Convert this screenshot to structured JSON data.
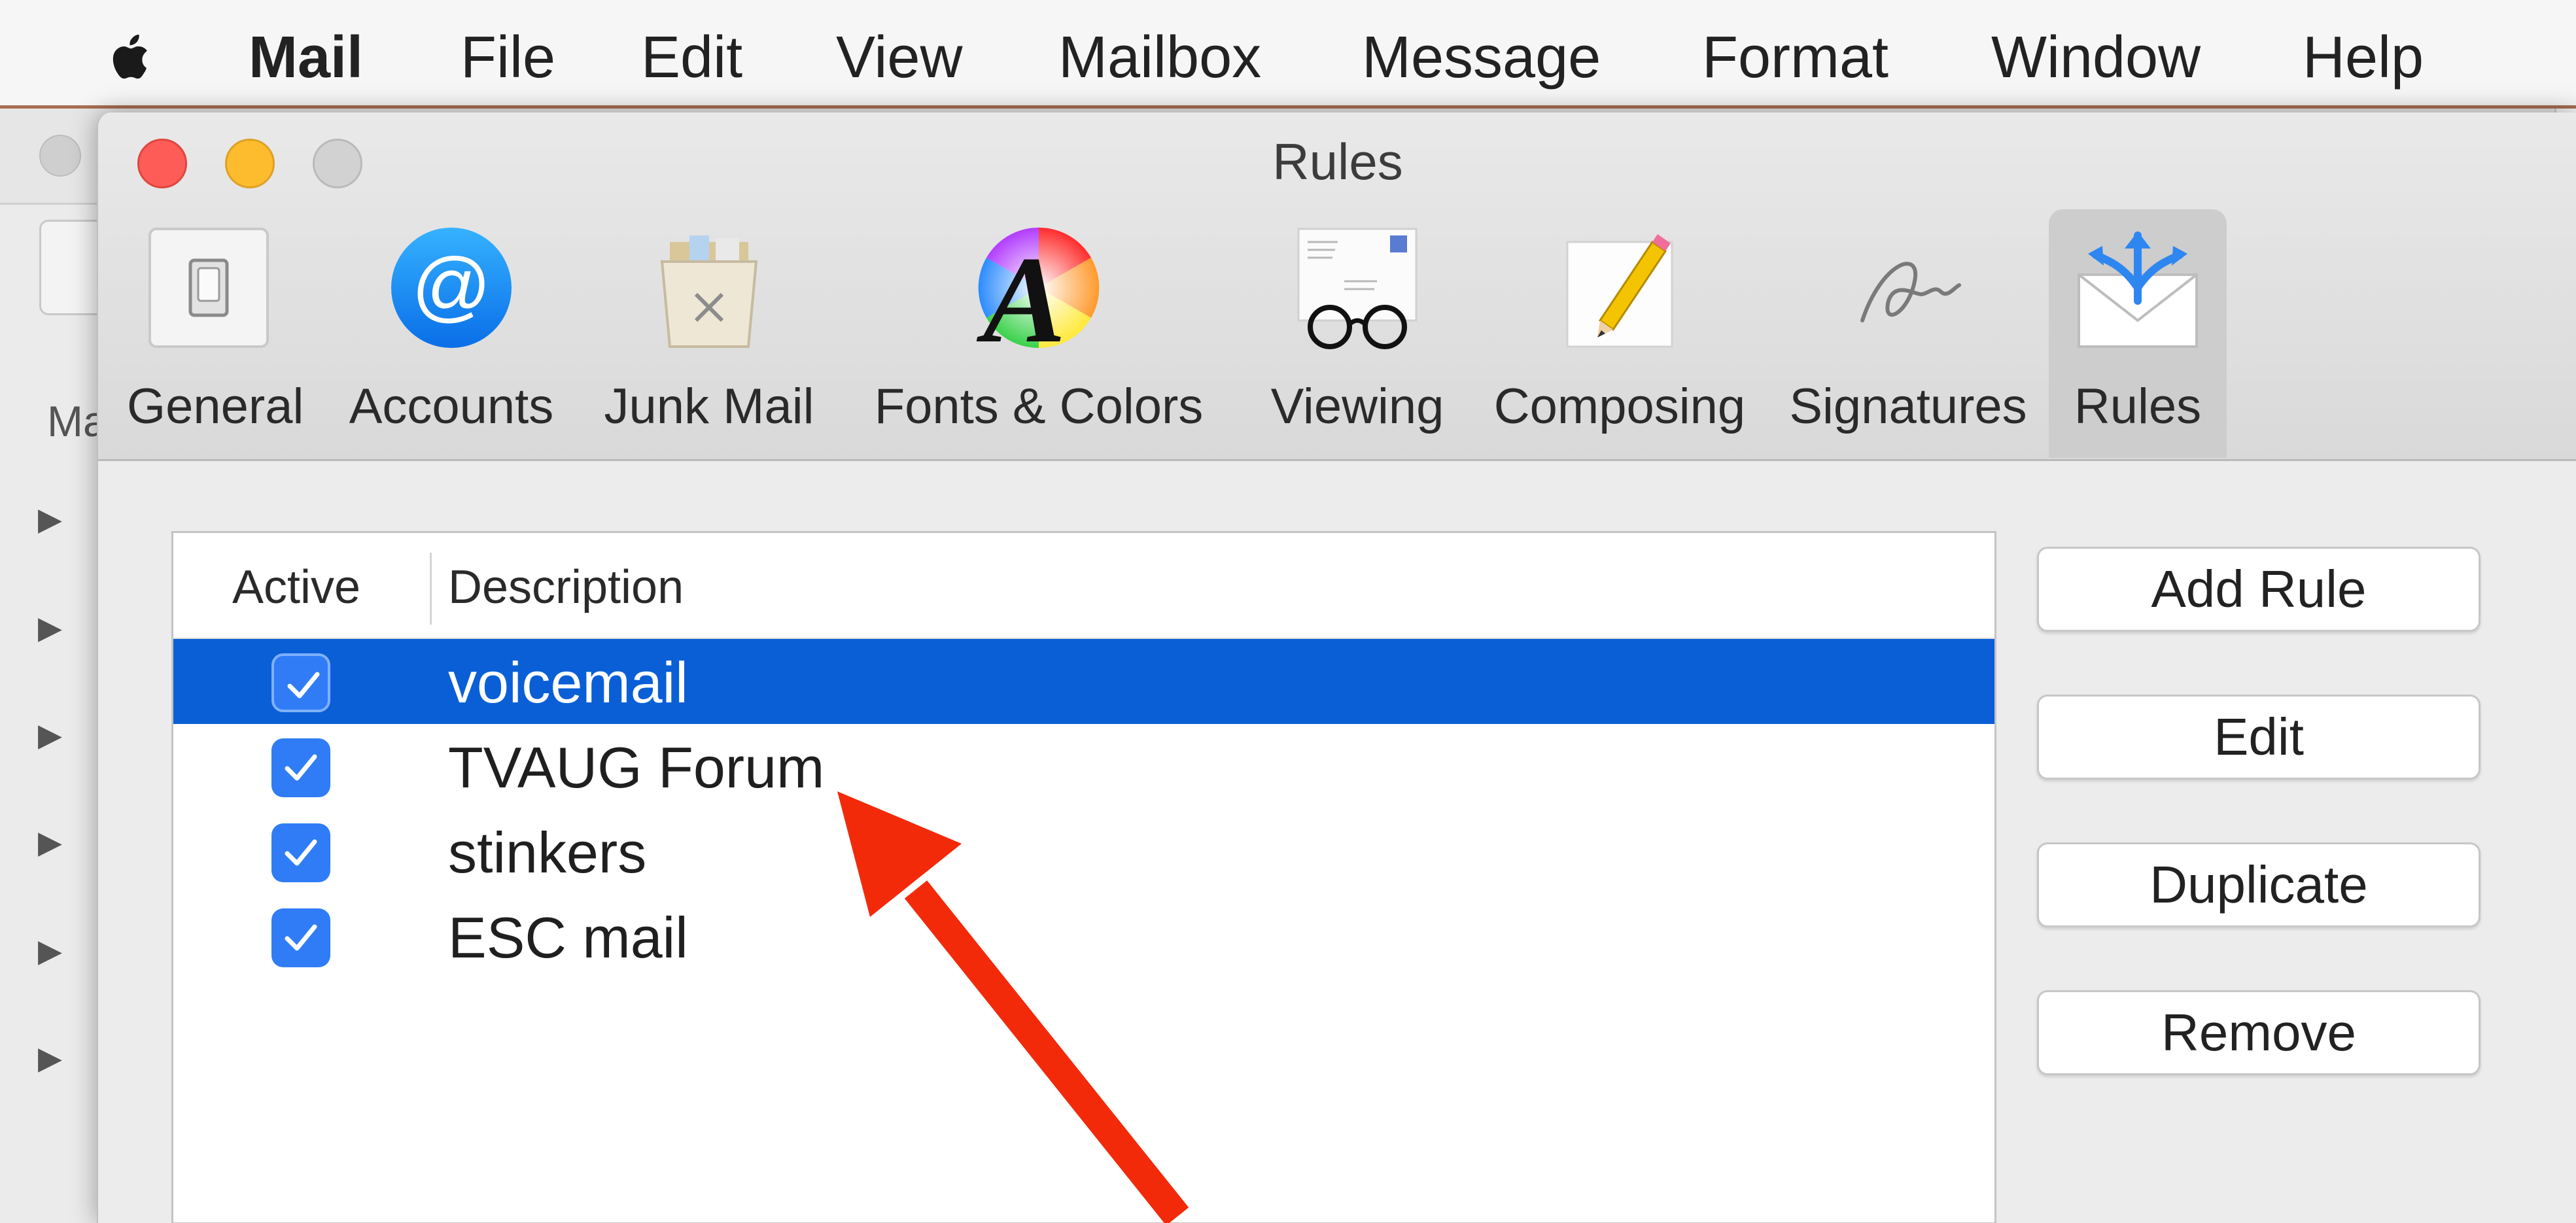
{
  "menubar": {
    "items": [
      "Mail",
      "File",
      "Edit",
      "View",
      "Mailbox",
      "Message",
      "Format",
      "Window",
      "Help"
    ]
  },
  "background_window": {
    "sidebar_header": "Ma"
  },
  "prefs_window": {
    "title": "Rules",
    "tabs": [
      {
        "label": "General",
        "icon": "light-switch-icon"
      },
      {
        "label": "Accounts",
        "icon": "at-sign-icon"
      },
      {
        "label": "Junk Mail",
        "icon": "trash-bin-icon"
      },
      {
        "label": "Fonts & Colors",
        "icon": "font-color-wheel-icon"
      },
      {
        "label": "Viewing",
        "icon": "glasses-letter-icon"
      },
      {
        "label": "Composing",
        "icon": "pencil-paper-icon"
      },
      {
        "label": "Signatures",
        "icon": "signature-icon"
      },
      {
        "label": "Rules",
        "icon": "envelope-arrows-icon",
        "selected": true
      }
    ]
  },
  "rules_table": {
    "headers": {
      "active": "Active",
      "description": "Description"
    },
    "rows": [
      {
        "name": "voicemail",
        "active": true,
        "selected": true
      },
      {
        "name": "TVAUG Forum",
        "active": true,
        "selected": false
      },
      {
        "name": "stinkers",
        "active": true,
        "selected": false
      },
      {
        "name": "ESC mail",
        "active": true,
        "selected": false
      }
    ]
  },
  "buttons": {
    "add_rule": "Add Rule",
    "edit": "Edit",
    "duplicate": "Duplicate",
    "remove": "Remove"
  },
  "colors": {
    "selection": "#0a5fd6",
    "checkbox": "#2f7cf6",
    "annotation_arrow": "#f22a0a"
  }
}
